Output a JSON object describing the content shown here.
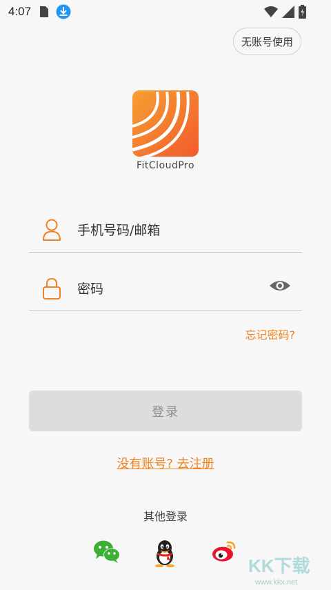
{
  "status_bar": {
    "time": "4:07",
    "left_icons": [
      "sim-card-icon",
      "download-icon"
    ],
    "right_icons": [
      "wifi-icon",
      "signal-icon",
      "battery-icon"
    ]
  },
  "header": {
    "guest_button_label": "无账号使用"
  },
  "logo": {
    "app_name": "FitCloudPro",
    "gradient_colors": [
      "#f6a033",
      "#f25a2c"
    ]
  },
  "form": {
    "phone_placeholder": "手机号码/邮箱",
    "phone_value": "",
    "password_placeholder": "密码",
    "password_value": "",
    "forgot_password": "忘记密码?",
    "login_button": "登录",
    "register_link": "没有账号? 去注册"
  },
  "social_login": {
    "label": "其他登录",
    "providers": [
      "wechat-icon",
      "qq-icon",
      "weibo-icon"
    ]
  },
  "watermark": {
    "text": "KK下载",
    "url": "www.kkx.net"
  },
  "colors": {
    "accent": "#f08321",
    "background": "#f7f7f7",
    "button_disabled": "#dddddd"
  }
}
